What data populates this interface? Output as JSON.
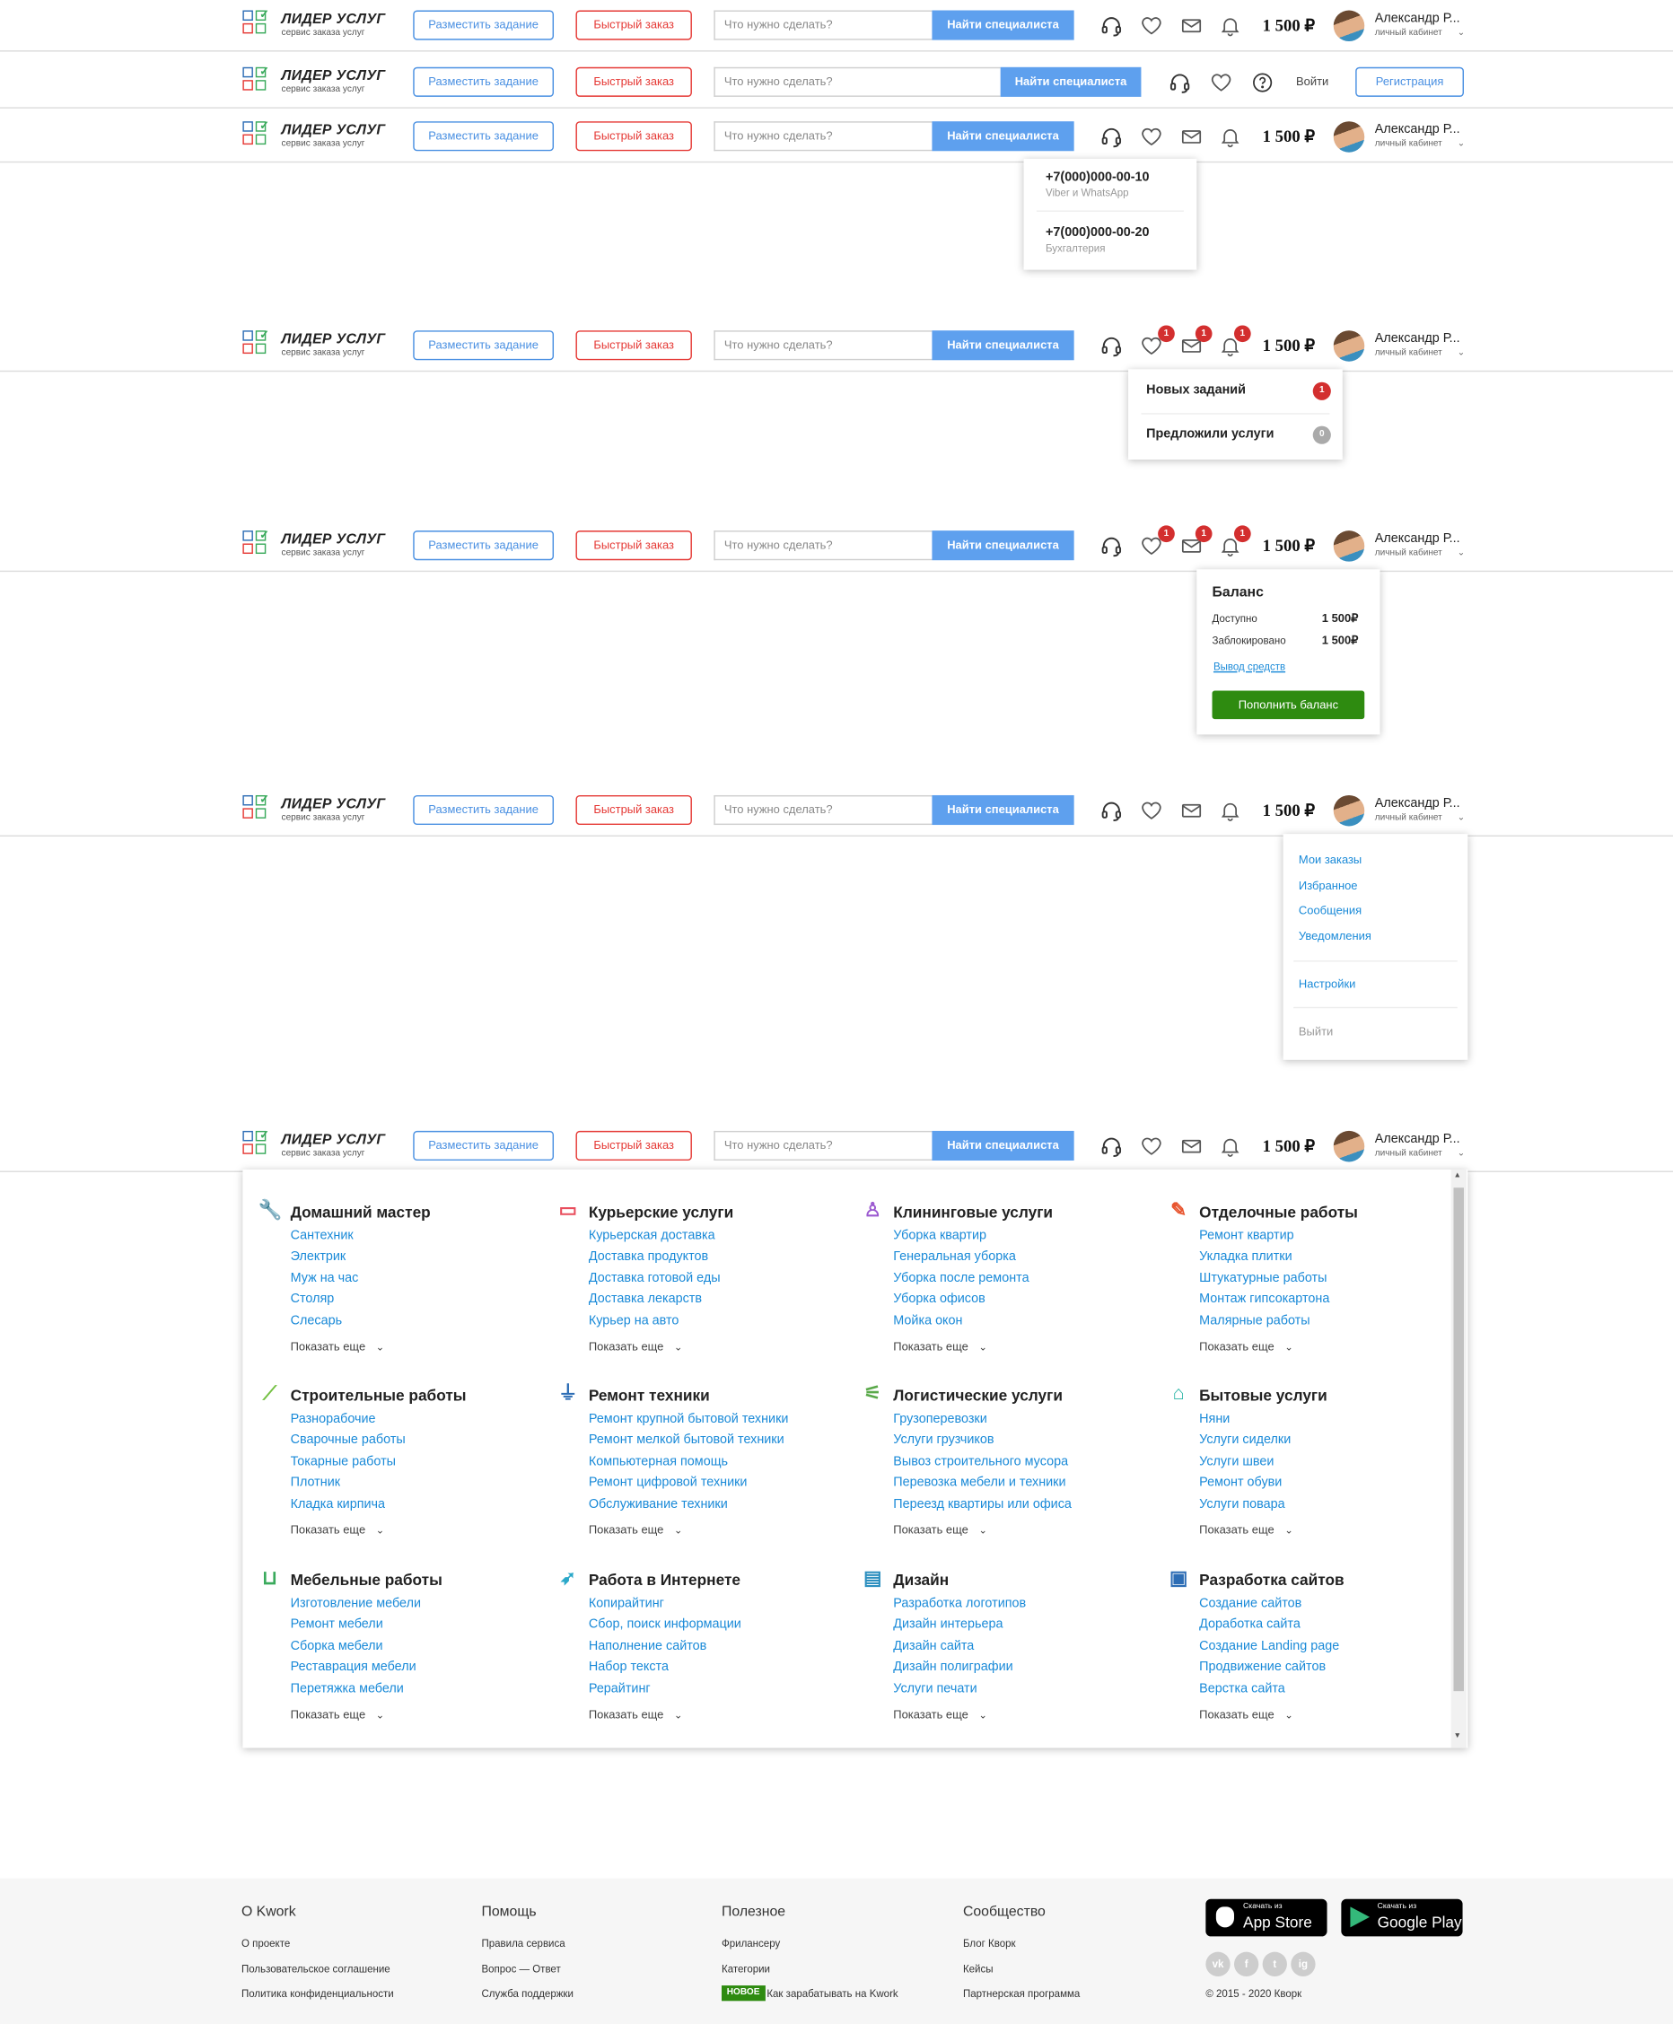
{
  "brand": {
    "name": "ЛИДЕР УСЛУГ",
    "tagline": "сервис заказа услуг"
  },
  "header": {
    "post_task": "Разместить задание",
    "quick_order": "Быстрый заказ",
    "search_placeholder": "Что нужно сделать?",
    "search_button": "Найти специалиста",
    "balance": "1 500 ₽",
    "user_name": "Александр Р...",
    "user_sub": "личный кабинет",
    "login": "Войти",
    "register": "Регистрация"
  },
  "badges": {
    "favorites": "1",
    "messages": "1",
    "notifications": "1"
  },
  "phones_popup": [
    {
      "phone": "+7(000)000-00-10",
      "label": "Viber и WhatsApp"
    },
    {
      "phone": "+7(000)000-00-20",
      "label": "Бухгалтерия"
    }
  ],
  "notify_popup": [
    {
      "label": "Новых заданий",
      "count": "1"
    },
    {
      "label": "Предложили услуги",
      "count": "0"
    }
  ],
  "balance_popup": {
    "title": "Баланс",
    "available_label": "Доступно",
    "available_value": "1 500₽",
    "blocked_label": "Заблокировано",
    "blocked_value": "1 500₽",
    "withdraw": "Вывод средств",
    "topup": "Пополнить баланс"
  },
  "user_menu": {
    "items": [
      "Мои заказы",
      "Избранное",
      "Сообщения",
      "Уведомления"
    ],
    "settings": "Настройки",
    "logout": "Выйти"
  },
  "categories": [
    {
      "title": "Домашний мастер",
      "icon": "wrench-icon",
      "color": "#f0883c",
      "items": [
        "Сантехник",
        "Электрик",
        "Муж на час",
        "Столяр",
        "Слесарь"
      ]
    },
    {
      "title": "Курьерские услуги",
      "icon": "box-icon",
      "color": "#e84d5c",
      "items": [
        "Курьерская доставка",
        "Доставка продуктов",
        "Доставка готовой еды",
        "Доставка лекарств",
        "Курьер на авто"
      ]
    },
    {
      "title": "Клининговые услуги",
      "icon": "broom-icon",
      "color": "#9b59d0",
      "items": [
        "Уборка квартир",
        "Генеральная уборка",
        "Уборка после ремонта",
        "Уборка офисов",
        "Мойка окон"
      ]
    },
    {
      "title": "Отделочные работы",
      "icon": "roller-icon",
      "color": "#e8552f",
      "items": [
        "Ремонт квартир",
        "Укладка плитки",
        "Штукатурные работы",
        "Монтаж гипсокартона",
        "Малярные работы"
      ]
    },
    {
      "title": "Строительные работы",
      "icon": "trowel-icon",
      "color": "#74c043",
      "items": [
        "Разнорабочие",
        "Сварочные работы",
        "Токарные работы",
        "Плотник",
        "Кладка кирпича"
      ]
    },
    {
      "title": "Ремонт техники",
      "icon": "plug-icon",
      "color": "#2d6db5",
      "items": [
        "Ремонт крупной бытовой техники",
        "Ремонт мелкой бытовой техники",
        "Компьютерная помощь",
        "Ремонт цифровой техники",
        "Обслуживание техники"
      ]
    },
    {
      "title": "Логистические услуги",
      "icon": "dolly-icon",
      "color": "#5aa94a",
      "items": [
        "Грузоперевозки",
        "Услуги грузчиков",
        "Вывоз строительного мусора",
        "Перевозка мебели и техники",
        "Переезд квартиры или офиса"
      ]
    },
    {
      "title": "Бытовые услуги",
      "icon": "house-icon",
      "color": "#2bb5a6",
      "items": [
        "Няни",
        "Услуги сиделки",
        "Услуги швеи",
        "Ремонт обуви",
        "Услуги повара"
      ]
    },
    {
      "title": "Мебельные работы",
      "icon": "armchair-icon",
      "color": "#3aaa5c",
      "items": [
        "Изготовление мебели",
        "Ремонт мебели",
        "Сборка мебели",
        "Реставрация мебели",
        "Перетяжка мебели"
      ]
    },
    {
      "title": "Работа в Интернете",
      "icon": "cursor-icon",
      "color": "#2aa8c9",
      "items": [
        "Копирайтинг",
        "Сбор, поиск информации",
        "Наполнение сайтов",
        "Набор текста",
        "Рерайтинг"
      ]
    },
    {
      "title": "Дизайн",
      "icon": "tablet-pen-icon",
      "color": "#2d8fbf",
      "items": [
        "Разработка логотипов",
        "Дизайн интерьера",
        "Дизайн сайта",
        "Дизайн полиграфии",
        "Услуги печати"
      ]
    },
    {
      "title": "Разработка сайтов",
      "icon": "browser-icon",
      "color": "#2d6db5",
      "items": [
        "Создание сайтов",
        "Доработка сайта",
        "Создание Landing page",
        "Продвижение сайтов",
        "Верстка сайта"
      ]
    }
  ],
  "show_more": "Показать еще",
  "footer": {
    "cols": [
      {
        "title": "О Kwork",
        "links": [
          "О проекте",
          "Пользовательское соглашение",
          "Политика конфиденциальности"
        ]
      },
      {
        "title": "Помощь",
        "links": [
          "Правила сервиса",
          "Вопрос — Ответ",
          "Служба поддержки"
        ]
      },
      {
        "title": "Полезное",
        "links": [
          "Фрилансеру",
          "Категории",
          "Как зарабатывать на Kwork"
        ]
      },
      {
        "title": "Сообщество",
        "links": [
          "Блог Кворк",
          "Кейсы",
          "Партнерская программа"
        ]
      }
    ],
    "new_badge": "НОВОЕ",
    "appstore_small": "Скачать из",
    "appstore": "App Store",
    "gplay_small": "Скачать из",
    "gplay": "Google Play",
    "social": [
      "vk",
      "f",
      "t",
      "ig"
    ],
    "copyright": "© 2015 - 2020 Кворк"
  }
}
